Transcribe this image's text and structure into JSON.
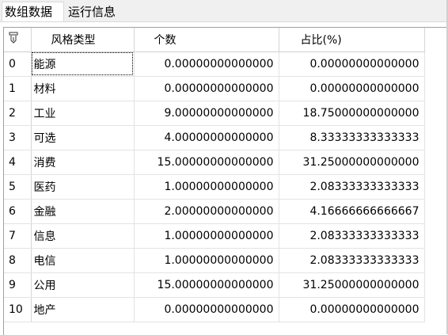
{
  "tabs": [
    {
      "label": "数组数据",
      "active": true
    },
    {
      "label": "运行信息",
      "active": false
    }
  ],
  "grid": {
    "header_icon": "row-selector-icon",
    "columns": [
      "风格类型",
      "个数",
      "占比(%)"
    ],
    "rows": [
      {
        "index": "0",
        "type": "能源",
        "count": "0.00000000000000",
        "ratio": "0.00000000000000"
      },
      {
        "index": "1",
        "type": "材料",
        "count": "0.00000000000000",
        "ratio": "0.00000000000000"
      },
      {
        "index": "2",
        "type": "工业",
        "count": "9.00000000000000",
        "ratio": "18.75000000000000"
      },
      {
        "index": "3",
        "type": "可选",
        "count": "4.00000000000000",
        "ratio": "8.33333333333333"
      },
      {
        "index": "4",
        "type": "消费",
        "count": "15.00000000000000",
        "ratio": "31.25000000000000"
      },
      {
        "index": "5",
        "type": "医药",
        "count": "1.00000000000000",
        "ratio": "2.08333333333333"
      },
      {
        "index": "6",
        "type": "金融",
        "count": "2.00000000000000",
        "ratio": "4.16666666666667"
      },
      {
        "index": "7",
        "type": "信息",
        "count": "1.00000000000000",
        "ratio": "2.08333333333333"
      },
      {
        "index": "8",
        "type": "电信",
        "count": "1.00000000000000",
        "ratio": "2.08333333333333"
      },
      {
        "index": "9",
        "type": "公用",
        "count": "15.00000000000000",
        "ratio": "31.25000000000000"
      },
      {
        "index": "10",
        "type": "地产",
        "count": "0.00000000000000",
        "ratio": "0.00000000000000"
      }
    ]
  }
}
